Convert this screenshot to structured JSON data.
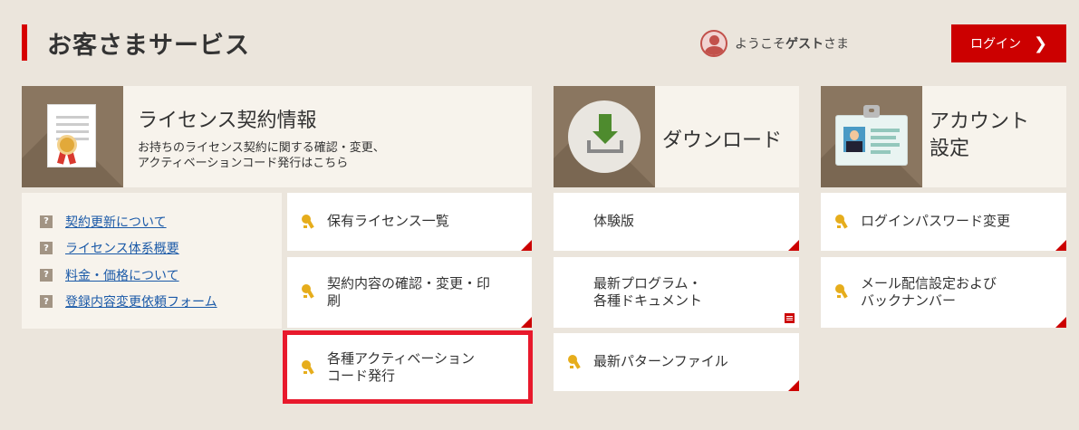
{
  "header": {
    "title": "お客さまサービス",
    "welcome_prefix": "ようこそ",
    "welcome_name": "ゲスト",
    "welcome_suffix": "さま",
    "login_label": "ログイン",
    "login_chevron": "❯"
  },
  "license": {
    "title": "ライセンス契約情報",
    "desc_line1": "お持ちのライセンス契約に関する確認・変更、",
    "desc_line2": "アクティベーションコード発行はこちら",
    "faq": [
      "契約更新について",
      "ライセンス体系概要",
      "料金・価格について",
      "登録内容変更依頼フォーム"
    ],
    "tiles": [
      {
        "line1": "保有ライセンス一覧",
        "line2": ""
      },
      {
        "line1": "契約内容の確認・変更・印",
        "line2": "刷"
      },
      {
        "line1": "各種アクティベーション",
        "line2": "コード発行"
      }
    ]
  },
  "download": {
    "title": "ダウンロード",
    "tiles": [
      {
        "line1": "体験版",
        "line2": ""
      },
      {
        "line1": "最新プログラム・",
        "line2": "各種ドキュメント"
      },
      {
        "line1": "最新パターンファイル",
        "line2": ""
      }
    ]
  },
  "account": {
    "title_line1": "アカウント",
    "title_line2": "設定",
    "tiles": [
      {
        "line1": "ログインパスワード変更",
        "line2": ""
      },
      {
        "line1": "メール配信設定および",
        "line2": "バックナンバー"
      }
    ]
  },
  "faq_marker": "?",
  "colors": {
    "accent": "#cc0000",
    "highlight": "#e8192c",
    "background": "#ebe5dc",
    "panel": "#f7f3ec",
    "link": "#1b5aa8",
    "key": "#e6ad1c"
  },
  "icons": [
    "user-avatar-icon",
    "chevron-right-icon",
    "certificate-icon",
    "download-icon",
    "id-card-icon",
    "key-icon",
    "document-icon",
    "question-icon"
  ]
}
